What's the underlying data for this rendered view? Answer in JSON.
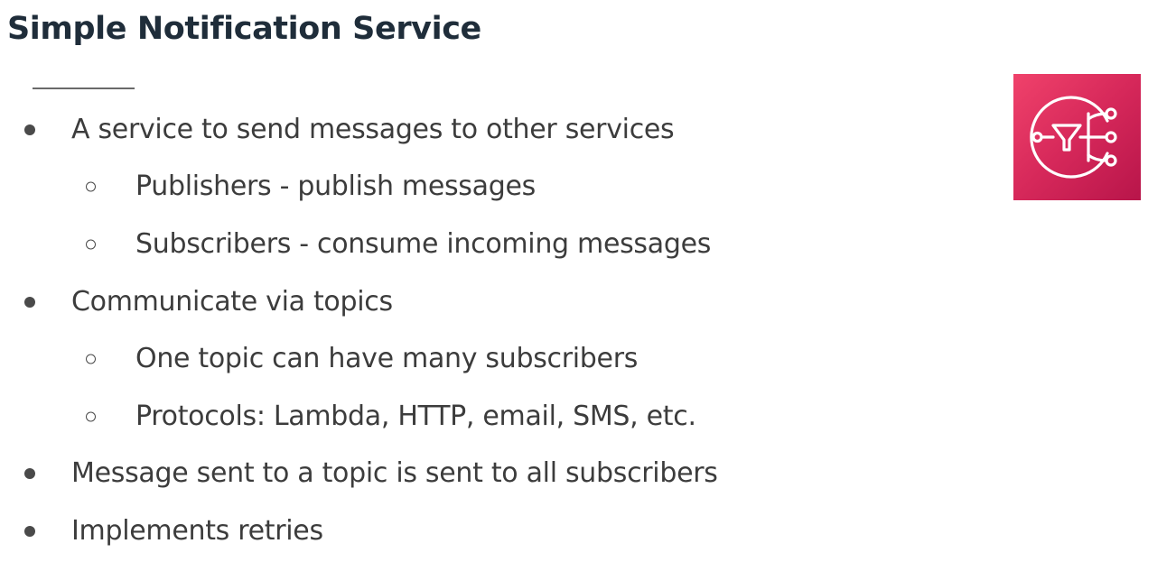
{
  "slide": {
    "title": "Simple Notification Service",
    "bullets": [
      {
        "level": 1,
        "text": "A service to send messages to other services"
      },
      {
        "level": 2,
        "text": "Publishers - publish messages"
      },
      {
        "level": 2,
        "text": "Subscribers - consume incoming messages"
      },
      {
        "level": 1,
        "text": "Communicate via topics"
      },
      {
        "level": 2,
        "text": "One topic can have many subscribers"
      },
      {
        "level": 2,
        "text": "Protocols: Lambda, HTTP, email, SMS, etc."
      },
      {
        "level": 1,
        "text": "Message sent to a topic is sent to all subscribers"
      },
      {
        "level": 1,
        "text": "Implements retries"
      }
    ]
  },
  "logo": {
    "icon": "aws-sns-icon",
    "colors": {
      "gradient_start": "#f0426b",
      "gradient_end": "#b8154a",
      "glyph": "#ffffff"
    }
  }
}
